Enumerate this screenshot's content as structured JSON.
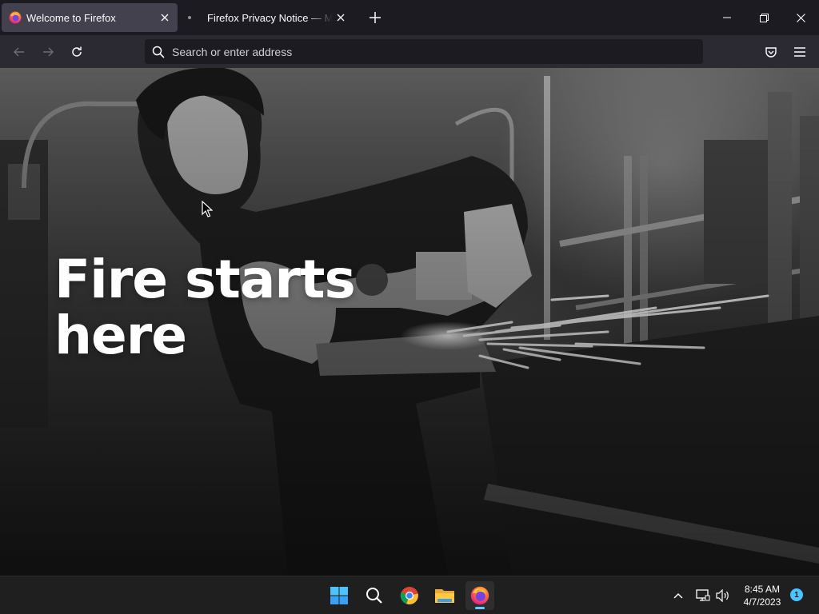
{
  "browser": {
    "tabs": [
      {
        "title": "Welcome to Firefox",
        "active": true
      },
      {
        "title": "Firefox Privacy Notice — Mozilla",
        "active": false
      }
    ],
    "address_bar": {
      "placeholder": "Search or enter address",
      "value": ""
    }
  },
  "content": {
    "hero_line1": "Fire starts",
    "hero_line2": "here"
  },
  "taskbar": {
    "apps": [
      "windows-start",
      "search",
      "chrome",
      "file-explorer",
      "firefox"
    ],
    "time": "8:45 AM",
    "date": "4/7/2023",
    "notification_count": "1"
  },
  "colors": {
    "tabstrip_bg": "#1c1b22",
    "active_tab_bg": "#42414d",
    "navbar_bg": "#2b2a33",
    "urlbar_bg": "#1c1b22",
    "taskbar_bg": "#1f1f1f",
    "accent_blue": "#60cdff"
  }
}
